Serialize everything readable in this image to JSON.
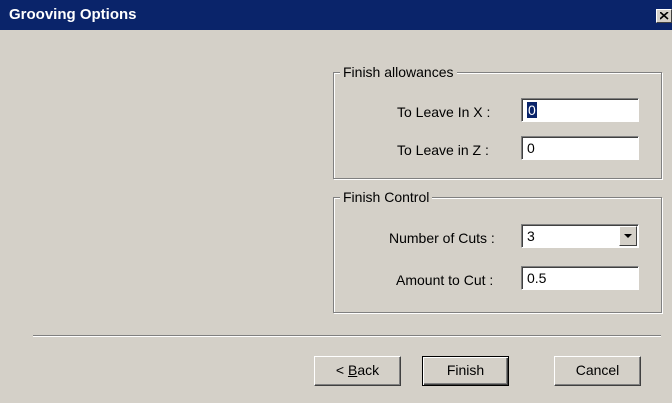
{
  "window": {
    "title": "Grooving Options"
  },
  "finish_allowances": {
    "legend": "Finish allowances",
    "to_leave_x_label": "To Leave In X :",
    "to_leave_x_value": "0",
    "to_leave_z_label": "To Leave in Z :",
    "to_leave_z_value": "0"
  },
  "finish_control": {
    "legend": "Finish Control",
    "num_cuts_label": "Number of Cuts :",
    "num_cuts_value": "3",
    "amount_label": "Amount to Cut :",
    "amount_value": "0.5"
  },
  "buttons": {
    "back_prefix": "< ",
    "back_accel": "B",
    "back_rest": "ack",
    "finish": "Finish",
    "cancel": "Cancel"
  },
  "icons": {
    "close": "close-icon",
    "dropdown": "chevron-down-icon"
  },
  "colors": {
    "titlebar": "#0a246a",
    "face": "#d4d0c8",
    "selection": "#0a246a"
  }
}
